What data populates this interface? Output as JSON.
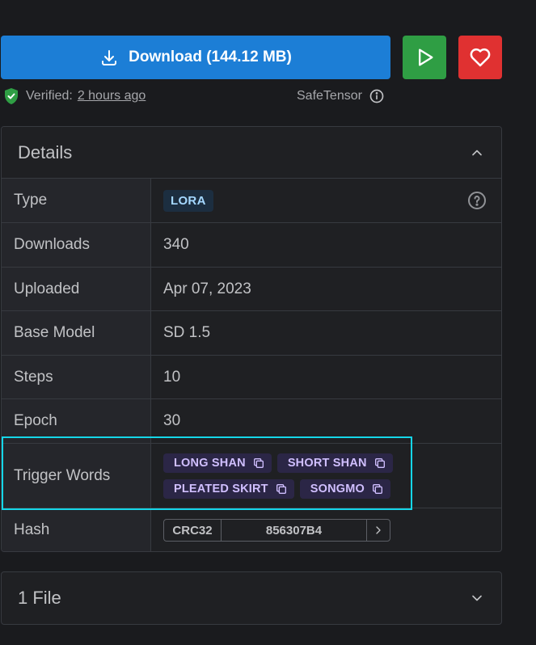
{
  "actions": {
    "download_label": "Download (144.12 MB)",
    "colors": {
      "download": "#1c7ed6",
      "play": "#2f9e44",
      "like": "#e03131"
    }
  },
  "meta": {
    "verified_prefix": "Verified:",
    "verified_time": "2 hours ago",
    "format": "SafeTensor"
  },
  "details": {
    "title": "Details",
    "type_label": "Type",
    "type_value": "LORA",
    "downloads_label": "Downloads",
    "downloads_value": "340",
    "uploaded_label": "Uploaded",
    "uploaded_value": "Apr 07, 2023",
    "base_model_label": "Base Model",
    "base_model_value": "SD 1.5",
    "steps_label": "Steps",
    "steps_value": "10",
    "epoch_label": "Epoch",
    "epoch_value": "30",
    "trigger_label": "Trigger Words",
    "trigger_words": [
      "LONG SHAN",
      "SHORT SHAN",
      "PLEATED SKIRT",
      "SONGMO"
    ],
    "hash_label": "Hash",
    "hash_type": "CRC32",
    "hash_value": "856307B4"
  },
  "files": {
    "title": "1 File"
  },
  "icons": [
    "download-icon",
    "play-icon",
    "heart-icon",
    "shield-check-icon",
    "info-icon",
    "chevron-up-icon",
    "help-icon",
    "copy-icon",
    "chevron-right-icon",
    "chevron-down-icon"
  ]
}
